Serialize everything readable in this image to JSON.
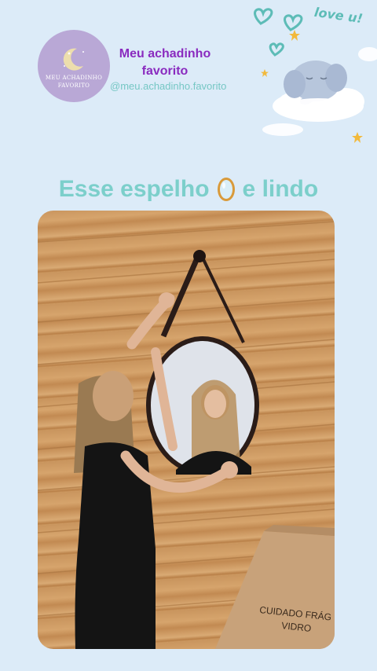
{
  "brand": {
    "logo_line1": "MEU ACHADINHO",
    "logo_line2": "FAVORITO",
    "name_line1": "Meu achadinho",
    "name_line2": "favorito",
    "handle": "@meu.achadinho.favorito"
  },
  "decor": {
    "love_text": "love u!",
    "icons": [
      "heart-icon",
      "star-icon",
      "elephant-cloud-illustration",
      "cloud-icon"
    ]
  },
  "post": {
    "title_before": "Esse espelho",
    "title_after": "e lindo",
    "title_icon": "mirror-icon"
  },
  "photo": {
    "box_text_line1": "CUIDADO FRÁG",
    "box_text_line2": "VIDRO"
  },
  "colors": {
    "background": "#dcebf8",
    "brand_purple": "#8a2bbf",
    "teal": "#7ccfcb",
    "logo_bg": "#b9a8d6"
  }
}
